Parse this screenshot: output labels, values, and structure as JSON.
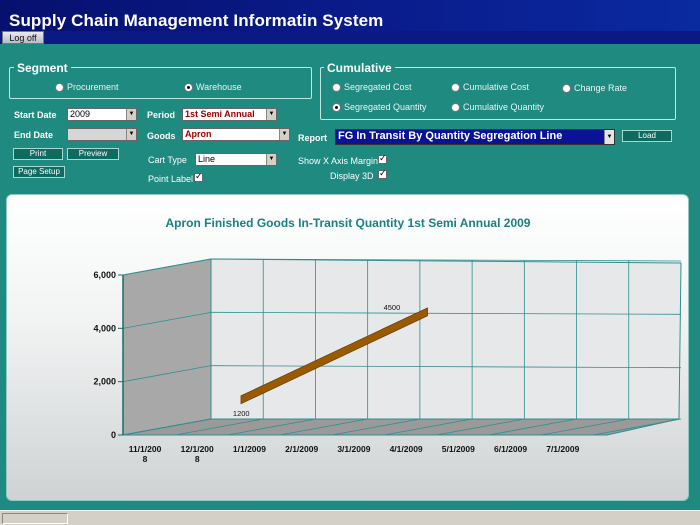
{
  "app": {
    "title": "Supply Chain Management Informatin System",
    "logoff_label": "Log off"
  },
  "segment": {
    "legend": "Segment",
    "options": [
      "Procurement",
      "Warehouse"
    ],
    "selected": "Warehouse"
  },
  "cumulative": {
    "legend": "Cumulative",
    "options": [
      "Segregated Cost",
      "Cumulative Cost",
      "Change Rate",
      "Segregated Quantity",
      "Cumulative Quantity"
    ],
    "selected": "Segregated Quantity"
  },
  "form": {
    "start_date_label": "Start Date",
    "start_date_value": "2009",
    "end_date_label": "End Date",
    "end_date_value": "",
    "period_label": "Period",
    "period_value": "1st Semi Annual",
    "goods_label": "Goods",
    "goods_value": "Apron",
    "report_label": "Report",
    "report_value": "FG In Transit By Quantity Segregation Line",
    "load_label": "Load",
    "print_label": "Print",
    "preview_label": "Preview",
    "page_setup_label": "Page Setup",
    "cart_type_label": "Cart Type",
    "cart_type_value": "Line",
    "point_label_label": "Point Label",
    "point_label_checked": true,
    "show_x_margin_label": "Show X Axis Margin",
    "show_x_margin_checked": true,
    "display_3d_label": "Display 3D",
    "display_3d_checked": true
  },
  "chart_data": {
    "type": "line",
    "title": "Apron Finished Goods In-Transit Quantity 1st Semi Annual 2009",
    "categories": [
      "11/1/2008",
      "12/1/2008",
      "1/1/2009",
      "2/1/2009",
      "3/1/2009",
      "4/1/2009",
      "5/1/2009",
      "6/1/2009",
      "7/1/2009"
    ],
    "category_labels": [
      [
        "11/1/200",
        "8"
      ],
      [
        "12/1/200",
        "8"
      ],
      [
        "1/1/2009"
      ],
      [
        "2/1/2009"
      ],
      [
        "3/1/2009"
      ],
      [
        "4/1/2009"
      ],
      [
        "5/1/2009"
      ],
      [
        "6/1/2009"
      ],
      [
        "7/1/2009"
      ]
    ],
    "series": [
      {
        "points": [
          {
            "x": "12/1/2008",
            "y": 1200
          },
          {
            "x": "3/1/2009",
            "y": 4500
          }
        ]
      }
    ],
    "point_labels": [
      "1200",
      "4500"
    ],
    "yticks": [
      0,
      2000,
      4000,
      6000
    ],
    "ytick_labels": [
      "0",
      "2,000",
      "4,000",
      "6,000"
    ],
    "ylim": [
      0,
      6000
    ],
    "display_3d": true,
    "grid": true,
    "colors": {
      "series": "#9a5a00",
      "series_edge": "#5a3400",
      "grid": "#2f8f8f"
    }
  }
}
